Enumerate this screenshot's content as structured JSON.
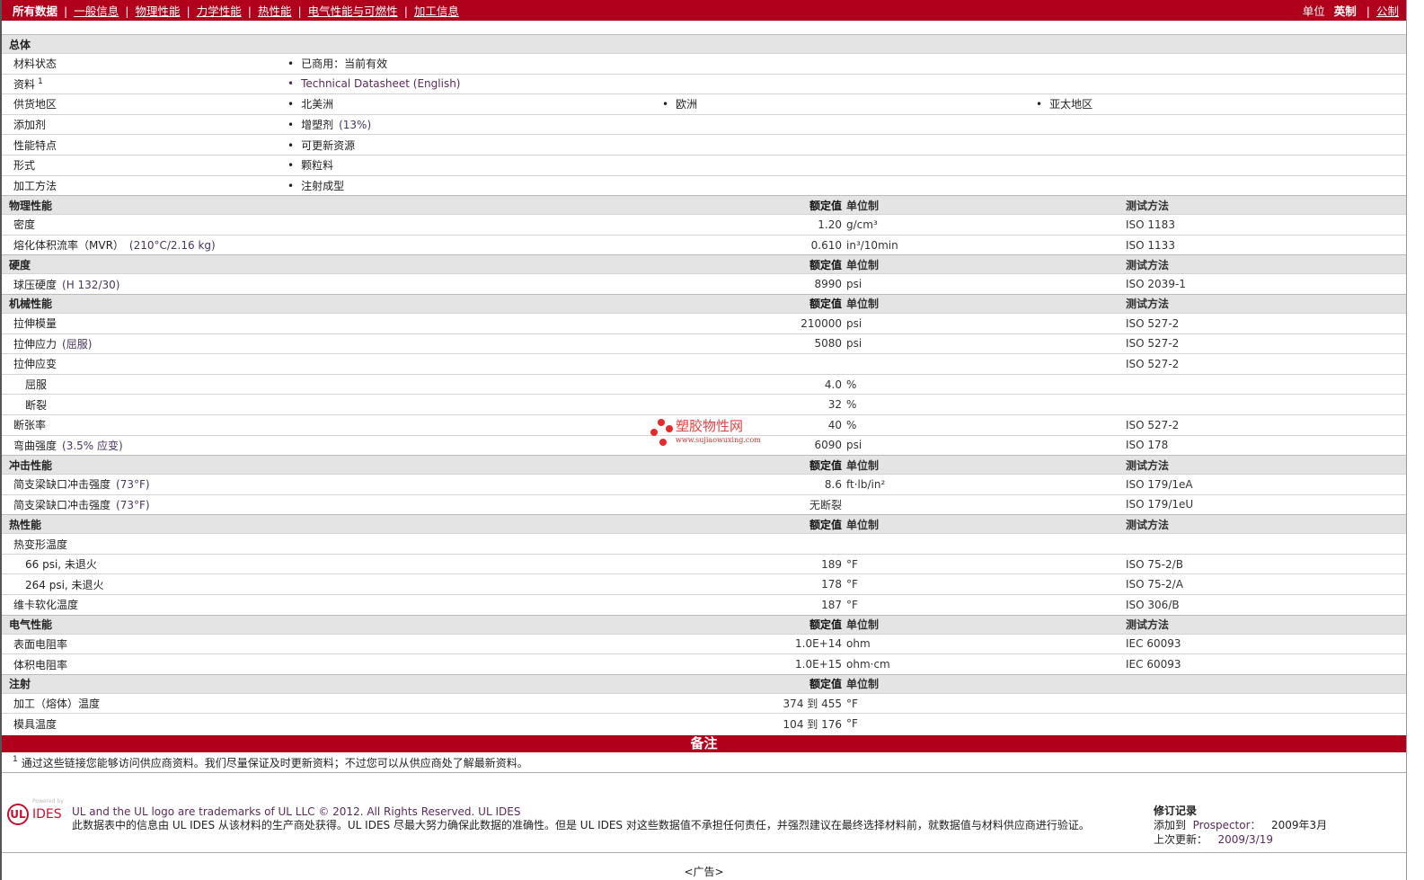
{
  "nav": {
    "items": [
      "所有数据",
      "一般信息",
      "物理性能",
      "力学性能",
      "热性能",
      "电气性能与可燃性",
      "加工信息"
    ],
    "unit_label": "单位",
    "unit_english": "英制",
    "unit_metric": "公制"
  },
  "general": {
    "title": "总体",
    "rows": [
      {
        "label": "材料状态",
        "cells": [
          "已商用：当前有效"
        ]
      },
      {
        "label": "资料",
        "sup": "1",
        "cells": [
          "Technical Datasheet (English)"
        ],
        "link": true
      },
      {
        "label": "供货地区",
        "cells": [
          "北美洲",
          "欧洲",
          "亚太地区"
        ]
      },
      {
        "label": "添加剂",
        "cells": [
          "增塑剂"
        ],
        "cond": "(13%)"
      },
      {
        "label": "性能特点",
        "cells": [
          "可更新资源"
        ]
      },
      {
        "label": "形式",
        "cells": [
          "颗粒料"
        ]
      },
      {
        "label": "加工方法",
        "cells": [
          "注射成型"
        ]
      }
    ]
  },
  "headers": {
    "value": "额定值",
    "unit": "单位制",
    "method": "测试方法"
  },
  "sections": [
    {
      "title": "物理性能",
      "method": true,
      "rows": [
        {
          "label": "密度",
          "value": "1.20",
          "unit": "g/cm³",
          "method": "ISO 1183"
        },
        {
          "label": "熔化体积流率（MVR）",
          "cond": "(210°C/2.16 kg)",
          "value": "0.610",
          "unit": "in³/10min",
          "method": "ISO 1133"
        }
      ]
    },
    {
      "title": "硬度",
      "method": true,
      "rows": [
        {
          "label": "球压硬度",
          "cond": "(H 132/30)",
          "value": "8990",
          "unit": "psi",
          "method": "ISO 2039-1"
        }
      ]
    },
    {
      "title": "机械性能",
      "method": true,
      "rows": [
        {
          "label": "拉伸模量",
          "value": "210000",
          "unit": "psi",
          "method": "ISO 527-2"
        },
        {
          "label": "拉伸应力",
          "cond": "(屈服)",
          "value": "5080",
          "unit": "psi",
          "method": "ISO 527-2"
        },
        {
          "label": "拉伸应变",
          "method": "ISO 527-2"
        },
        {
          "label": "屈服",
          "indent": true,
          "value": "4.0",
          "unit": "%"
        },
        {
          "label": "断裂",
          "indent": true,
          "value": "32",
          "unit": "%"
        },
        {
          "label": "断张率",
          "value": "40",
          "unit": "%",
          "method": "ISO 527-2"
        },
        {
          "label": "弯曲强度",
          "cond": "(3.5% 应变)",
          "value": "6090",
          "unit": "psi",
          "method": "ISO 178"
        }
      ]
    },
    {
      "title": "冲击性能",
      "method": true,
      "rows": [
        {
          "label": "简支梁缺口冲击强度",
          "cond": "(73°F)",
          "value": "8.6",
          "unit": "ft·lb/in²",
          "method": "ISO 179/1eA"
        },
        {
          "label": "简支梁缺口冲击强度",
          "cond": "(73°F)",
          "value": "无断裂",
          "method": "ISO 179/1eU"
        }
      ]
    },
    {
      "title": "热性能",
      "method": true,
      "rows": [
        {
          "label": "热变形温度"
        },
        {
          "label": "66 psi, 未退火",
          "indent": true,
          "value": "189",
          "unit": "°F",
          "method": "ISO 75-2/B"
        },
        {
          "label": "264 psi, 未退火",
          "indent": true,
          "value": "178",
          "unit": "°F",
          "method": "ISO 75-2/A"
        },
        {
          "label": "维卡软化温度",
          "value": "187",
          "unit": "°F",
          "method": "ISO 306/B"
        }
      ]
    },
    {
      "title": "电气性能",
      "method": true,
      "rows": [
        {
          "label": "表面电阻率",
          "value": "1.0E+14",
          "unit": "ohm",
          "method": "IEC 60093"
        },
        {
          "label": "体积电阻率",
          "value": "1.0E+15",
          "unit": "ohm·cm",
          "method": "IEC 60093"
        }
      ]
    },
    {
      "title": "注射",
      "method": false,
      "rows": [
        {
          "label": "加工（熔体）温度",
          "value": "374 到  455",
          "unit": "°F"
        },
        {
          "label": "模具温度",
          "value": "104 到  176",
          "unit": "°F"
        }
      ]
    }
  ],
  "remark": {
    "title": "备注",
    "sup": "1",
    "text": "通过这些链接您能够访问供应商资料。我们尽量保证及时更新资料；不过您可以从供应商处了解最新资料。"
  },
  "watermark": {
    "title": "塑胶物性网",
    "url": "www.sujiaowuxing.com"
  },
  "footer": {
    "logo_powered": "Powered by",
    "logo_text": "IDES",
    "logo_ul": "UL",
    "line1": "UL and the UL logo are trademarks of UL LLC © 2012. All Rights Reserved. UL IDES",
    "line2": "此数据表中的信息由  UL IDES 从该材料的生产商处获得。UL IDES 尽最大努力确保此数据的准确性。但是  UL IDES 对这些数据值不承担任何责任，并强烈建议在最终选择材料前，就数据值与材料供应商进行验证。",
    "rev_title": "修订记录",
    "rev_added_label": "添加到",
    "rev_added_site": "Prospector：",
    "rev_added_date": "2009年3月",
    "rev_updated_label": "上次更新：",
    "rev_updated_date": "2009/3/19"
  },
  "ad": "<广告>",
  "colors": {
    "brand": "#b0001c",
    "section_bg": "#e4e4e4"
  }
}
